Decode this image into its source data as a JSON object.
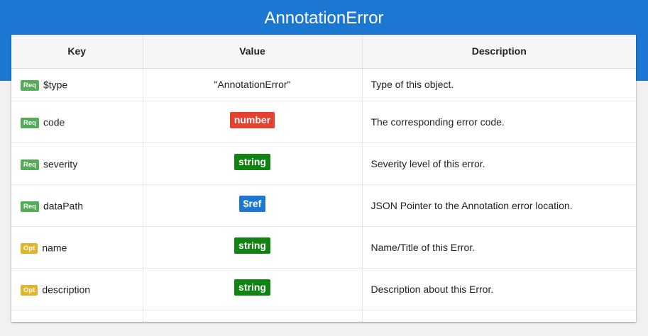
{
  "page": {
    "title": "AnnotationError"
  },
  "table": {
    "headers": {
      "key": "Key",
      "value": "Value",
      "description": "Description"
    },
    "rows": [
      {
        "flag": "Req",
        "key": "$type",
        "value_literal": "\"AnnotationError\"",
        "description": "Type of this object."
      },
      {
        "flag": "Req",
        "key": "code",
        "value_type": "number",
        "description": "The corresponding error code."
      },
      {
        "flag": "Req",
        "key": "severity",
        "value_type": "string",
        "description": "Severity level of this error."
      },
      {
        "flag": "Req",
        "key": "dataPath",
        "value_type": "$ref",
        "description": "JSON Pointer to the Annotation error location."
      },
      {
        "flag": "Opt",
        "key": "name",
        "value_type": "string",
        "description": "Name/Title of this Error."
      },
      {
        "flag": "Opt",
        "key": "description",
        "value_type": "string",
        "description": "Description about this Error."
      }
    ]
  },
  "colors": {
    "header_blue": "#1c77d3",
    "req_green": "#53ad57",
    "opt_yellow": "#e0b42b",
    "number_red": "#e5412f",
    "string_green": "#118312",
    "ref_blue": "#1c77d3"
  }
}
